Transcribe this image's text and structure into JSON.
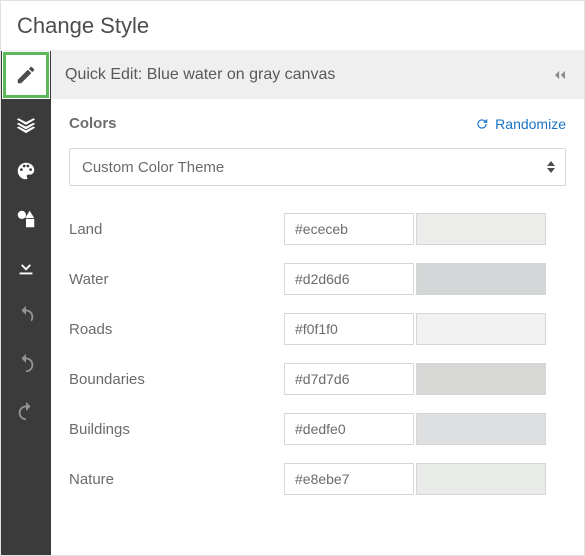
{
  "title": "Change Style",
  "quick_edit": {
    "label": "Quick Edit: Blue water on gray canvas"
  },
  "section_label": "Colors",
  "randomize_label": "Randomize",
  "theme_select": "Custom Color Theme",
  "rows": [
    {
      "name": "Land",
      "hex": "#ececeb"
    },
    {
      "name": "Water",
      "hex": "#d2d6d6"
    },
    {
      "name": "Roads",
      "hex": "#f0f1f0"
    },
    {
      "name": "Boundaries",
      "hex": "#d7d7d6"
    },
    {
      "name": "Buildings",
      "hex": "#dedfe0"
    },
    {
      "name": "Nature",
      "hex": "#e8ebe7"
    }
  ],
  "toolbar": [
    {
      "id": "edit",
      "selected": true,
      "enabled": true
    },
    {
      "id": "layers",
      "selected": false,
      "enabled": true
    },
    {
      "id": "palette",
      "selected": false,
      "enabled": true
    },
    {
      "id": "shapes",
      "selected": false,
      "enabled": true
    },
    {
      "id": "download",
      "selected": false,
      "enabled": true
    },
    {
      "id": "reset",
      "selected": false,
      "enabled": false
    },
    {
      "id": "undo",
      "selected": false,
      "enabled": false
    },
    {
      "id": "redo",
      "selected": false,
      "enabled": false
    }
  ]
}
